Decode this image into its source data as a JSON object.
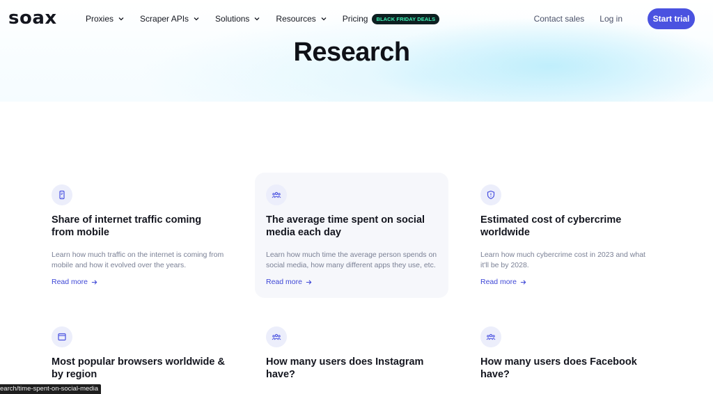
{
  "brand": {
    "logo_text": "soax"
  },
  "nav": {
    "items": [
      {
        "label": "Proxies",
        "has_dropdown": true
      },
      {
        "label": "Scraper APIs",
        "has_dropdown": true
      },
      {
        "label": "Solutions",
        "has_dropdown": true
      },
      {
        "label": "Resources",
        "has_dropdown": true
      }
    ],
    "pricing_label": "Pricing",
    "promo_badge": "BLACK FRIDAY DEALS",
    "contact_sales": "Contact sales",
    "login": "Log in",
    "start_trial": "Start trial"
  },
  "page": {
    "title": "Research"
  },
  "cards": [
    {
      "icon": "mobile-icon",
      "title": "Share of internet traffic coming from mobile",
      "description": "Learn how much traffic on the internet is coming from mobile and how it evolved over the years.",
      "link": "Read more",
      "highlighted": false
    },
    {
      "icon": "users-icon",
      "title": "The average time spent on social media each day",
      "description": "Learn how much time the average person spends on social media, how many different apps they use, etc.",
      "link": "Read more",
      "highlighted": true
    },
    {
      "icon": "shield-icon",
      "title": "Estimated cost of cybercrime worldwide",
      "description": "Learn how much cybercrime cost in 2023 and what it'll be by 2028.",
      "link": "Read more",
      "highlighted": false
    },
    {
      "icon": "browser-icon",
      "title": "Most popular browsers worldwide & by region",
      "description": "",
      "link": "",
      "highlighted": false
    },
    {
      "icon": "users-icon",
      "title": "How many users does Instagram have?",
      "description": "",
      "link": "",
      "highlighted": false
    },
    {
      "icon": "users-icon",
      "title": "How many users does Facebook have?",
      "description": "",
      "link": "",
      "highlighted": false
    }
  ],
  "status_bar": {
    "url_text": "earch/time-spent-on-social-media"
  },
  "colors": {
    "accent": "#4a52e0",
    "link": "#3d46d6",
    "badge_bg": "#0d1f21",
    "badge_text": "#41f3b6"
  }
}
